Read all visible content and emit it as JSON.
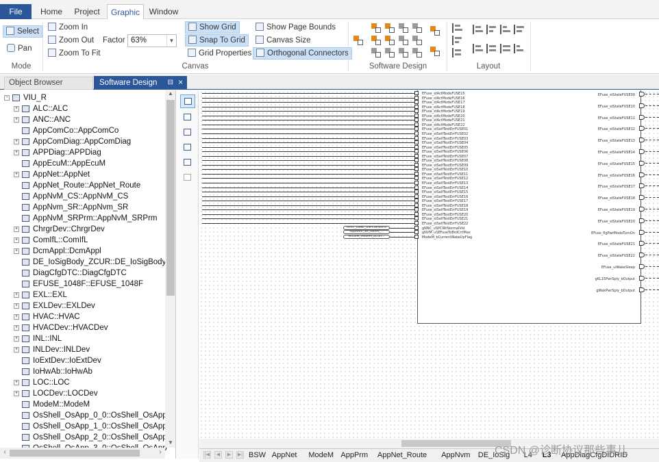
{
  "menu": {
    "file": "File",
    "tabs": [
      "Home",
      "Project",
      "Graphic",
      "Window"
    ],
    "active_tab": "Graphic"
  },
  "ribbon": {
    "mode": {
      "label": "Mode",
      "select": "Select",
      "pan": "Pan"
    },
    "canvas": {
      "label": "Canvas",
      "zoom_in": "Zoom In",
      "zoom_out": "Zoom Out",
      "zoom_to_fit": "Zoom To Fit",
      "factor_label": "Factor",
      "factor_value": "63%",
      "show_grid": "Show Grid",
      "snap_to_grid": "Snap To Grid",
      "grid_properties": "Grid Properties",
      "show_page_bounds": "Show Page Bounds",
      "canvas_size": "Canvas Size",
      "orthogonal_connectors": "Orthogonal Connectors"
    },
    "software_design": {
      "label": "Software Design"
    },
    "layout": {
      "label": "Layout"
    }
  },
  "doc_tabs": {
    "object_browser": "Object Browser",
    "software_design": "Software Design",
    "close": "×",
    "pin": "⊟"
  },
  "tree": {
    "root": "VIU_R",
    "items": [
      {
        "label": "ALC::ALC",
        "exp": true
      },
      {
        "label": "ANC::ANC",
        "exp": true
      },
      {
        "label": "AppComCo::AppComCo",
        "exp": false
      },
      {
        "label": "AppComDiag::AppComDiag",
        "exp": true
      },
      {
        "label": "APPDiag::APPDiag",
        "exp": true
      },
      {
        "label": "AppEcuM::AppEcuM",
        "exp": false
      },
      {
        "label": "AppNet::AppNet",
        "exp": true
      },
      {
        "label": "AppNet_Route::AppNet_Route",
        "exp": false
      },
      {
        "label": "AppNvM_CS::AppNvM_CS",
        "exp": false
      },
      {
        "label": "AppNvm_SR::AppNvm_SR",
        "exp": false
      },
      {
        "label": "AppNvM_SRPrm::AppNvM_SRPrm",
        "exp": false
      },
      {
        "label": "ChrgrDev::ChrgrDev",
        "exp": true
      },
      {
        "label": "ComIfL::ComIfL",
        "exp": true
      },
      {
        "label": "DcmAppl::DcmAppl",
        "exp": true
      },
      {
        "label": "DE_IoSigBody_ZCUR::DE_IoSigBody_Z",
        "exp": false
      },
      {
        "label": "DiagCfgDTC::DiagCfgDTC",
        "exp": false
      },
      {
        "label": "EFUSE_1048F::EFUSE_1048F",
        "exp": false
      },
      {
        "label": "EXL::EXL",
        "exp": true
      },
      {
        "label": "EXLDev::EXLDev",
        "exp": true
      },
      {
        "label": "HVAC::HVAC",
        "exp": true
      },
      {
        "label": "HVACDev::HVACDev",
        "exp": true
      },
      {
        "label": "INL::INL",
        "exp": true
      },
      {
        "label": "INLDev::INLDev",
        "exp": true
      },
      {
        "label": "IoExtDev::IoExtDev",
        "exp": false
      },
      {
        "label": "IoHwAb::IoHwAb",
        "exp": false
      },
      {
        "label": "LOC::LOC",
        "exp": true
      },
      {
        "label": "LOCDev::LOCDev",
        "exp": true
      },
      {
        "label": "ModeM::ModeM",
        "exp": false
      },
      {
        "label": "OsShell_OsApp_0_0::OsShell_OsApp_",
        "exp": false
      },
      {
        "label": "OsShell_OsApp_1_0::OsShell_OsApp_",
        "exp": false
      },
      {
        "label": "OsShell_OsApp_2_0::OsShell_OsApp_",
        "exp": false
      },
      {
        "label": "OsShell_OsApp_3_0::OsShell_OsApp",
        "exp": false
      }
    ]
  },
  "component": {
    "in_ports": [
      "EFuse_stActModeFUSE15",
      "EFuse_stActModeFUSE16",
      "EFuse_stActModeFUSE17",
      "EFuse_stActModeFUSE18",
      "EFuse_stActModeFUSE19",
      "EFuse_stActModeFUSE20",
      "EFuse_stActModeFUSE21",
      "EFuse_stActModeFUSE22",
      "EFuse_stSelfTestErrFUSE01",
      "EFuse_stSelfTestErrFUSE02",
      "EFuse_stSelfTestErrFUSE03",
      "EFuse_stSelfTestErrFUSE04",
      "EFuse_stSelfTestErrFUSE05",
      "EFuse_stSelfTestErrFUSE06",
      "EFuse_stSelfTestErrFUSE07",
      "EFuse_stSelfTestErrFUSE08",
      "EFuse_stSelfTestErrFUSE09",
      "EFuse_stSelfTestErrFUSE10",
      "EFuse_stSelfTestErrFUSE11",
      "EFuse_stSelfTestErrFUSE12",
      "EFuse_stSelfTestErrFUSE13",
      "EFuse_stSelfTestErrFUSE14",
      "EFuse_stSelfTestErrFUSE15",
      "EFuse_stSelfTestErrFUSE16",
      "EFuse_stSelfTestErrFUSE17",
      "EFuse_stSelfTestErrFUSE18",
      "EFuse_stSelfTestErrFUSE19",
      "EFuse_stSelfTestErrFUSE20",
      "EFuse_stSelfTestErrFUSE21",
      "EFuse_stSelfTestErrFUSE22",
      "gNNC_uSPCWrNormalVld",
      "gNVM_uSEFuseToBrdCntMax",
      "ModeM_bCurrentWakeUpFlag"
    ],
    "sender_ovals": [
      "AnnC_uSNC_uSPCWrNorm",
      "AppNvm_SR_uNVM_...",
      "ModeM_ModeM_bCurr..."
    ],
    "out_ports": [
      "EFuse_stStateFUSE09",
      "EFuse_stStateFUSE10",
      "EFuse_stStateFUSE11",
      "EFuse_stStateFUSE12",
      "EFuse_stStateFUSE13",
      "EFuse_stStateFUSE14",
      "EFuse_stStateFUSE15",
      "EFuse_stStateFUSE16",
      "EFuse_stStateFUSE17",
      "EFuse_stStateFUSE18",
      "EFuse_stStateFUSE19",
      "EFuse_stStateFUSE20",
      "EFuse_flgPwrModeTurnOn",
      "EFuse_stStateFUSE21",
      "EFuse_stStateFUSE22",
      "EFuse_uiWakeSleep",
      "gKL15PwrSply_bOutput",
      "gWakPwrSply_bOutput"
    ]
  },
  "sheet_tabs": [
    "BSW",
    "AppNet",
    "ModeM",
    "AppPrm",
    "AppNet_Route",
    "AppNvm",
    "DE_IoSig",
    "L4",
    "L3",
    "AppDiagCfgDIDRID"
  ],
  "active_sheet": "L3",
  "watermark": "CSDN @诊断协议那些事儿",
  "colors": {
    "accent": "#2b579a",
    "selected": "#c9e0f7"
  }
}
